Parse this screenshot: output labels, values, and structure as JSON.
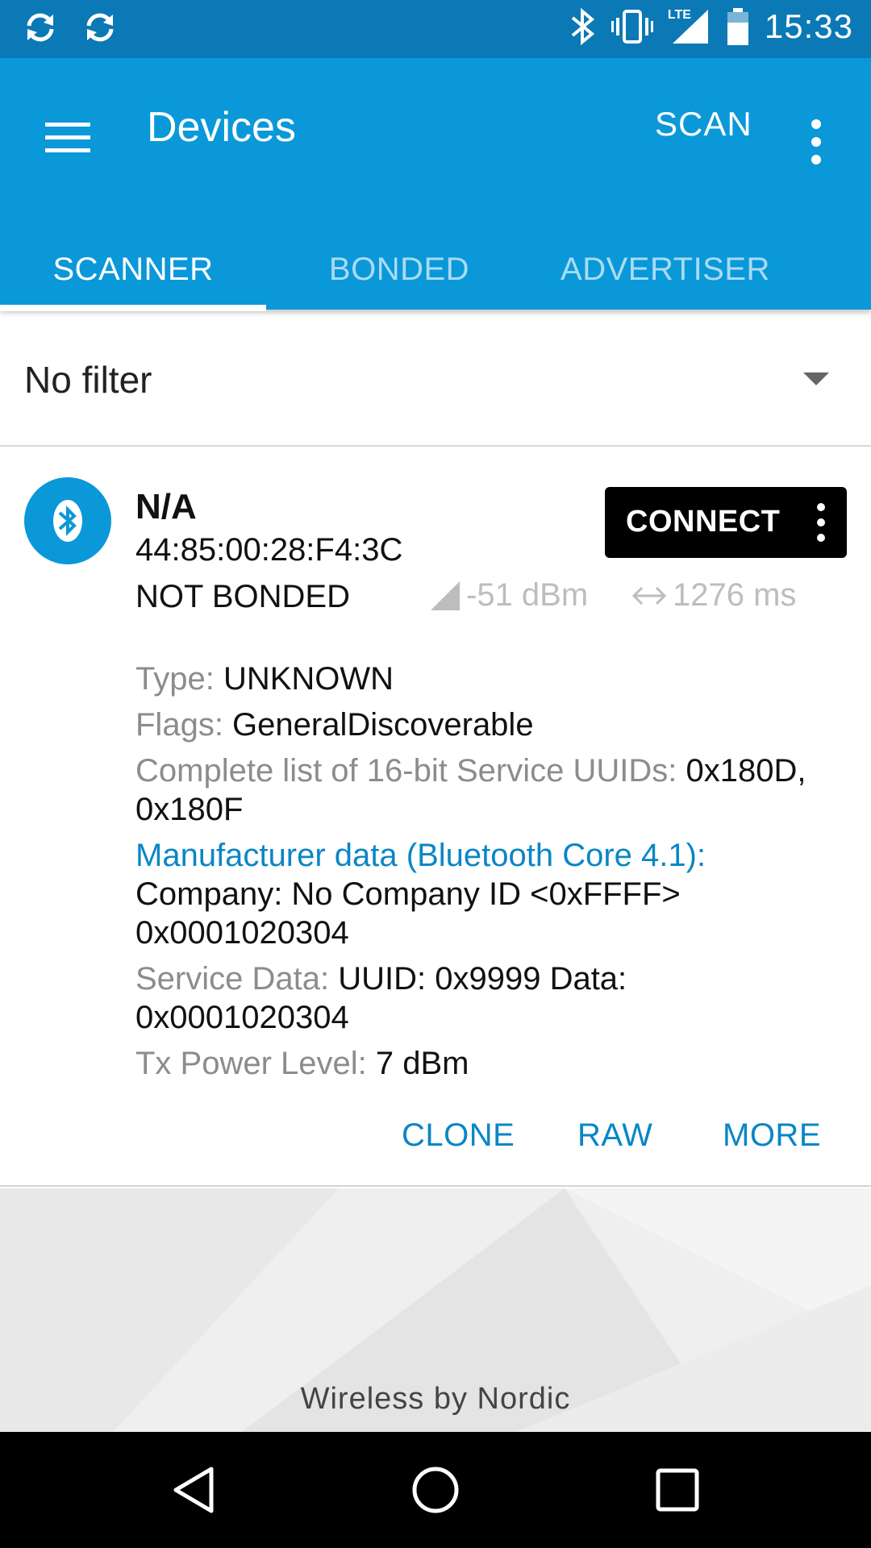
{
  "status_bar": {
    "time": "15:33",
    "network": "LTE",
    "left_icons": [
      "sync-icon",
      "sync-icon"
    ],
    "right_icons": [
      "bluetooth-icon",
      "vibrate-icon",
      "signal-icon",
      "battery-icon"
    ]
  },
  "app_bar": {
    "title": "Devices",
    "scan_label": "SCAN",
    "color": "#0a98d9",
    "tabs": [
      {
        "label": "SCANNER",
        "active": true
      },
      {
        "label": "BONDED",
        "active": false
      },
      {
        "label": "ADVERTISER",
        "active": false
      }
    ]
  },
  "filter": {
    "label": "No filter"
  },
  "device": {
    "name": "N/A",
    "address": "44:85:00:28:F4:3C",
    "bond_state": "NOT BONDED",
    "rssi": "-51 dBm",
    "interval": "1276 ms",
    "connect_label": "CONNECT",
    "details": {
      "type_label": "Type: ",
      "type_value": "UNKNOWN",
      "flags_label": "Flags: ",
      "flags_value": "GeneralDiscoverable",
      "uuids_label": "Complete list of 16-bit Service UUIDs: ",
      "uuids_value": "0x180D, 0x180F",
      "manufacturer_label": "Manufacturer data (Bluetooth Core 4.1):",
      "manufacturer_company": "Company: No Company ID <0xFFFF>",
      "manufacturer_value": "0x0001020304",
      "service_data_label": "Service Data: ",
      "service_data_value": "UUID: 0x9999 Data: 0x0001020304",
      "tx_power_label": "Tx Power Level: ",
      "tx_power_value": "7 dBm"
    },
    "actions": {
      "clone": "CLONE",
      "raw": "RAW",
      "more": "MORE"
    }
  },
  "footer": {
    "brand": "Wireless by Nordic"
  },
  "colors": {
    "status_bar": "#0a79b5",
    "primary": "#0a98d9",
    "accent_text": "#0a86c6"
  }
}
